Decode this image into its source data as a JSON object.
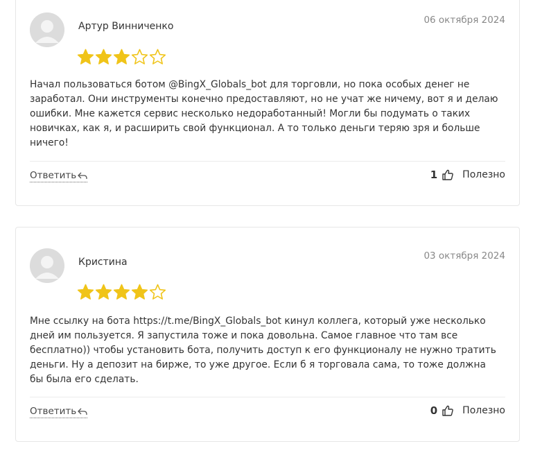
{
  "colors": {
    "star_filled": "#f0c419",
    "star_empty_outline": "#f0c419",
    "avatar_bg": "#dcdcdc",
    "border": "#e6e6e6"
  },
  "reviews": [
    {
      "author": "Артур Винниченко",
      "date": "06 октября 2024",
      "rating": 3,
      "rating_max": 5,
      "text": "Начал пользоваться ботом @BingX_Globals_bot для торговли, но пока особых денег не заработал. Они инструменты конечно предоставляют, но не учат же ничему, вот я и делаю ошибки. Мне кажется сервис несколько недоработанный! Могли бы подумать о таких новичках, как я, и расширить свой функционал. А то только деньги теряю зря и больше ничего!",
      "reply_label": "Ответить",
      "reply_icon": "reply-arrow-icon",
      "helpful_count": "1",
      "helpful_icon": "thumbs-up-icon",
      "helpful_label": "Полезно"
    },
    {
      "author": "Кристина",
      "date": "03 октября 2024",
      "rating": 4,
      "rating_max": 5,
      "text": "Мне ссылку на бота https://t.me/BingX_Globals_bot кинул коллега, который уже несколько дней им пользуется. Я запустила тоже и пока довольна. Самое главное что там все бесплатно)) чтобы установить бота, получить доступ к его функционалу не нужно тратить деньги. Ну а депозит на бирже, то уже другое. Если б я торговала сама, то тоже должна бы была его сделать.",
      "reply_label": "Ответить",
      "reply_icon": "reply-arrow-icon",
      "helpful_count": "0",
      "helpful_icon": "thumbs-up-icon",
      "helpful_label": "Полезно"
    }
  ]
}
